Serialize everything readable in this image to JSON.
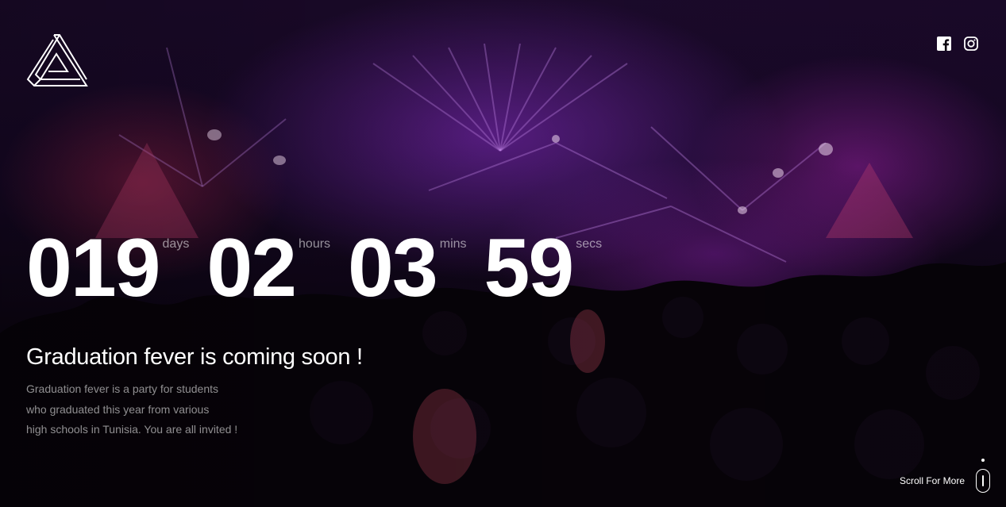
{
  "icons": {
    "logo": "impossible-triangle-logo-icon",
    "facebook": "facebook-icon",
    "instagram": "instagram-icon",
    "scroll": "mouse-scroll-icon"
  },
  "colors": {
    "text_primary": "#ffffff",
    "text_muted": "#a8a3ad",
    "accent_purple": "#9b3de0"
  },
  "countdown": {
    "days": {
      "value": "019",
      "label": "days"
    },
    "hours": {
      "value": "02",
      "label": "hours"
    },
    "mins": {
      "value": "03",
      "label": "mins"
    },
    "secs": {
      "value": "59",
      "label": "secs"
    }
  },
  "hero": {
    "headline": "Graduation fever is coming soon !",
    "description": [
      "Graduation fever is a party for students",
      "who graduated this year from various",
      "high schools in Tunisia. You are all invited !"
    ]
  },
  "scroll": {
    "label": "Scroll For More"
  }
}
